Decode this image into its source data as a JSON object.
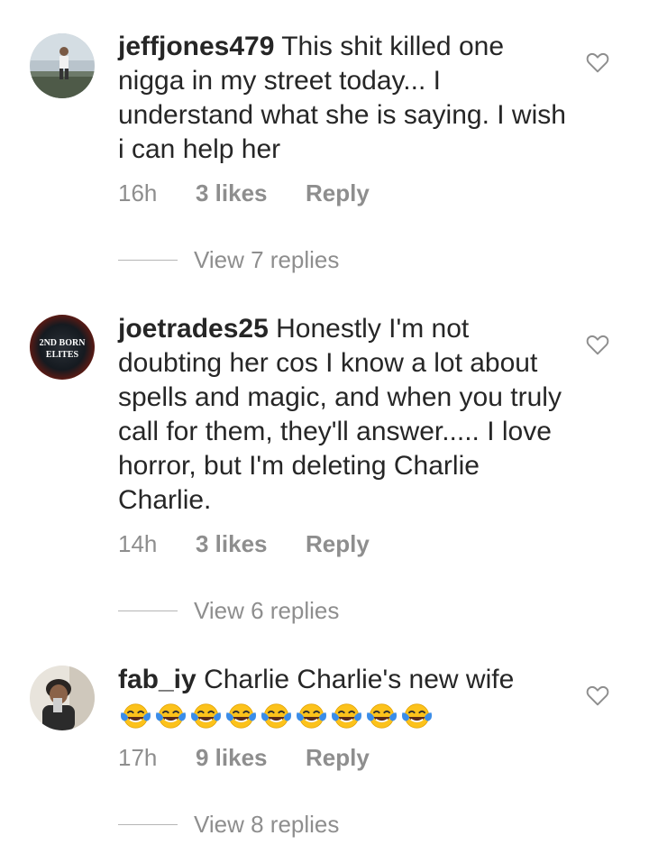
{
  "comments": [
    {
      "username": "jeffjones479",
      "text": "This shit killed one nigga in my street today... I understand what she is saying. I wish i can help her",
      "time": "16h",
      "likes": "3 likes",
      "reply": "Reply",
      "view_replies": "View 7 replies"
    },
    {
      "username": "joetrades25",
      "text": "Honestly I'm not doubting her cos I know a lot about spells and magic, and when you truly call for them, they'll answer..... I love horror, but I'm deleting Charlie Charlie.",
      "time": "14h",
      "likes": "3 likes",
      "reply": "Reply",
      "view_replies": "View 6 replies",
      "avatar_text_line1": "2ND BORN",
      "avatar_text_line2": "ELITES"
    },
    {
      "username": "fab_iy",
      "text": "Charlie Charlie's new wife",
      "emoji_count": 9,
      "emoji_name": "face-with-tears-of-joy-icon",
      "time": "17h",
      "likes": "9 likes",
      "reply": "Reply",
      "view_replies": "View 8 replies"
    }
  ],
  "colors": {
    "text": "#262626",
    "secondary": "#8e8e8e",
    "divider": "#b5b5b5"
  }
}
